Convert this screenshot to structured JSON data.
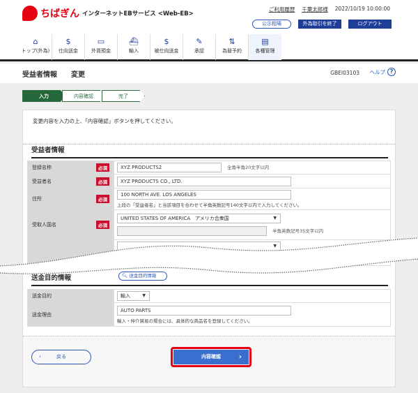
{
  "header": {
    "brand": "ちばぎん",
    "service": "インターネットEBサービス <Web-EB>",
    "links": [
      "ご利用履歴",
      "千葉太郎様"
    ],
    "datetime": "2022/10/19 10:00:00",
    "buttons": {
      "rates": "公示相場",
      "end_fx": "外為取引を終了",
      "logout": "ログアウト"
    }
  },
  "nav": [
    {
      "label": "トップ(外為)",
      "icon": "home-icon"
    },
    {
      "label": "仕向送金",
      "icon": "remittance-icon"
    },
    {
      "label": "外貨預金",
      "icon": "deposit-icon"
    },
    {
      "label": "輸入",
      "icon": "import-icon"
    },
    {
      "label": "被仕向送金",
      "icon": "incoming-icon"
    },
    {
      "label": "承認",
      "icon": "approve-icon"
    },
    {
      "label": "為替予約",
      "icon": "forex-icon"
    },
    {
      "label": "各種管理",
      "icon": "manage-icon"
    }
  ],
  "page": {
    "title": "受益者情報",
    "subtitle": "変更",
    "id": "GBEI03103",
    "help": "ヘルプ"
  },
  "steps": [
    "入力",
    "内容確認",
    "完了"
  ],
  "instruction": "変更内容を入力の上、「内容確認」ボタンを押してください。",
  "beneficiary": {
    "heading": "受益者情報",
    "required": "必須",
    "reg_name": {
      "label": "登録名称",
      "value": "XYZ PRODUCTS2",
      "note": "全角半角20文字以内"
    },
    "name": {
      "label": "受益者名",
      "value": "XYZ PRODUCTS CO., LTD."
    },
    "address": {
      "label": "住所",
      "value": "100 NORTH AVE. LOS ANGELES",
      "hint": "上段の「受益者名」と当該項目を合わせて半角英数記号140文字以内で入力してください。"
    },
    "country": {
      "label": "受取人国名",
      "value": "UNITED STATES OF AMERICA　アメリカ合衆国",
      "note": "半角英数記号35文字以内"
    }
  },
  "purpose": {
    "heading": "送金目的情報",
    "lookup": "送金目的情報",
    "purpose": {
      "label": "送金目的",
      "value": "輸入"
    },
    "reason": {
      "label": "送金理由",
      "value": "AUTO PARTS",
      "hint": "輸入・仲介貿易の場合には、具体的な商品名を登録してください。"
    }
  },
  "buttons": {
    "back": "戻る",
    "confirm": "内容確認"
  }
}
